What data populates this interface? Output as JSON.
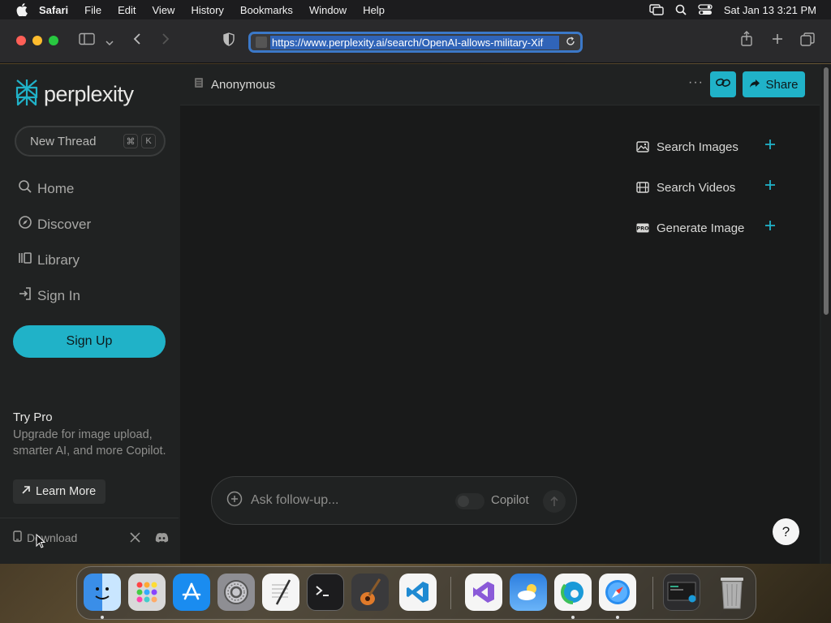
{
  "menubar": {
    "app": "Safari",
    "items": [
      "File",
      "Edit",
      "View",
      "History",
      "Bookmarks",
      "Window",
      "Help"
    ],
    "datetime": "Sat Jan 13  3:21 PM"
  },
  "browser": {
    "url": "https://www.perplexity.ai/search/OpenAI-allows-military-Xif"
  },
  "sidebar": {
    "logo_text": "perplexity",
    "new_thread": "New Thread",
    "shortcut_cmd": "⌘",
    "shortcut_key": "K",
    "nav": [
      {
        "label": "Home",
        "icon": "search-icon"
      },
      {
        "label": "Discover",
        "icon": "compass-icon"
      },
      {
        "label": "Library",
        "icon": "library-icon"
      },
      {
        "label": "Sign In",
        "icon": "sign-in-icon"
      }
    ],
    "signup": "Sign Up",
    "try_pro_title": "Try Pro",
    "try_pro_desc": "Upgrade for image upload, smarter AI, and more Copilot.",
    "learn_more": "Learn More",
    "download": "Download"
  },
  "main": {
    "user": "Anonymous",
    "more": "···",
    "share": "Share",
    "actions": [
      {
        "label": "Search Images",
        "icon": "image-icon"
      },
      {
        "label": "Search Videos",
        "icon": "film-icon"
      },
      {
        "label": "Generate Image",
        "icon": "pro-icon"
      }
    ],
    "ask_placeholder": "Ask follow-up...",
    "copilot": "Copilot",
    "help": "?"
  },
  "colors": {
    "accent": "#20b2c8",
    "background": "#191a1a",
    "sidebar": "#202222"
  },
  "dock": {
    "apps": [
      "Finder",
      "Launchpad",
      "App Store",
      "System Settings",
      "TextEdit",
      "Terminal",
      "GarageBand",
      "Visual Studio Code",
      "Visual Studio",
      "Weather",
      "Microsoft Edge",
      "Safari",
      "Screenshot",
      "Trash"
    ]
  }
}
